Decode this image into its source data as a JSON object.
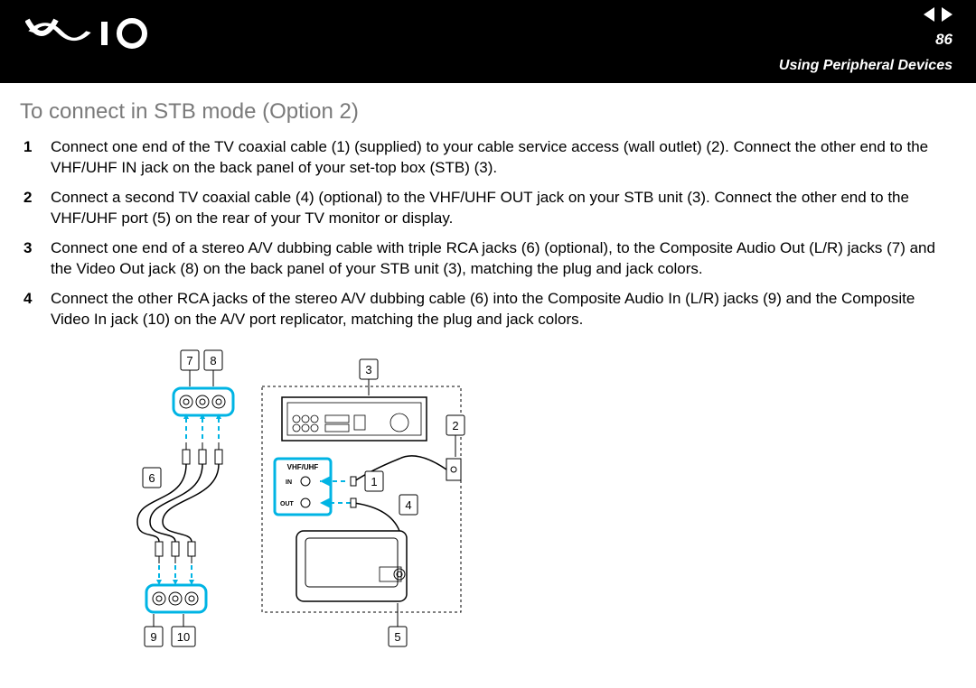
{
  "header": {
    "page_number": "86",
    "section_title": "Using Peripheral Devices"
  },
  "content": {
    "heading": "To connect in STB mode (Option 2)",
    "steps": [
      "Connect one end of the TV coaxial cable (1) (supplied) to your cable service access (wall outlet) (2). Connect the other end to the VHF/UHF IN jack on the back panel of your set-top box (STB) (3).",
      "Connect a second TV coaxial cable (4) (optional) to the VHF/UHF OUT jack on your STB unit (3). Connect the other end to the VHF/UHF port (5) on the rear of your TV monitor or display.",
      "Connect one end of a stereo A/V dubbing cable with triple RCA jacks (6) (optional), to the Composite Audio Out (L/R) jacks (7) and the Video Out jack (8) on the back panel of your STB unit (3), matching the plug and jack colors.",
      "Connect the other RCA jacks of the stereo A/V dubbing cable (6) into the Composite Audio In (L/R) jacks (9) and the Composite Video In jack (10) on the A/V port replicator, matching the plug and jack colors."
    ]
  },
  "diagram": {
    "callouts": [
      "1",
      "2",
      "3",
      "4",
      "5",
      "6",
      "7",
      "8",
      "9",
      "10"
    ],
    "labels": {
      "vhf_uhf": "VHF/UHF",
      "in": "IN",
      "out": "OUT"
    }
  }
}
